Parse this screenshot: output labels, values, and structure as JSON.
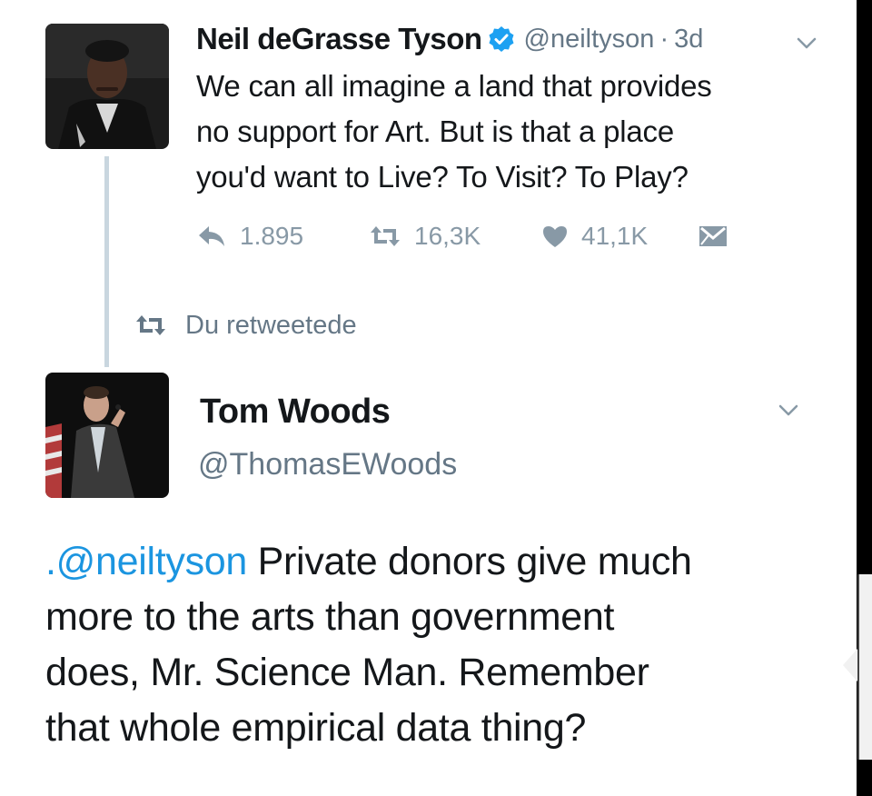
{
  "tweet_original": {
    "author_name": "Neil deGrasse Tyson",
    "handle": "@neiltyson",
    "separator": "·",
    "time": "3d",
    "text_lines": [
      "We can all imagine a land that provides",
      "no support for Art. But is that a place",
      "you'd want to Live? To Visit? To Play?"
    ],
    "reply_count": "1.895",
    "retweet_count": "16,3K",
    "like_count": "41,1K",
    "verified_color": "#1da1f2",
    "icons": [
      "reply-icon",
      "retweet-icon",
      "heart-icon",
      "direct-message-icon",
      "verified-badge-icon",
      "chevron-down-icon"
    ]
  },
  "retweet_notice": {
    "label": "Du retweetede",
    "icon": "retweet-icon"
  },
  "tweet_reply": {
    "author_name": "Tom Woods",
    "handle": "@ThomasEWoods",
    "mention": ".@neiltyson",
    "text_lines": [
      " Private donors give much",
      "more to the arts than government",
      "does, Mr. Science Man. Remember",
      "that whole empirical data thing?"
    ],
    "mention_color": "#1b95e0",
    "icons": [
      "chevron-down-icon"
    ]
  }
}
